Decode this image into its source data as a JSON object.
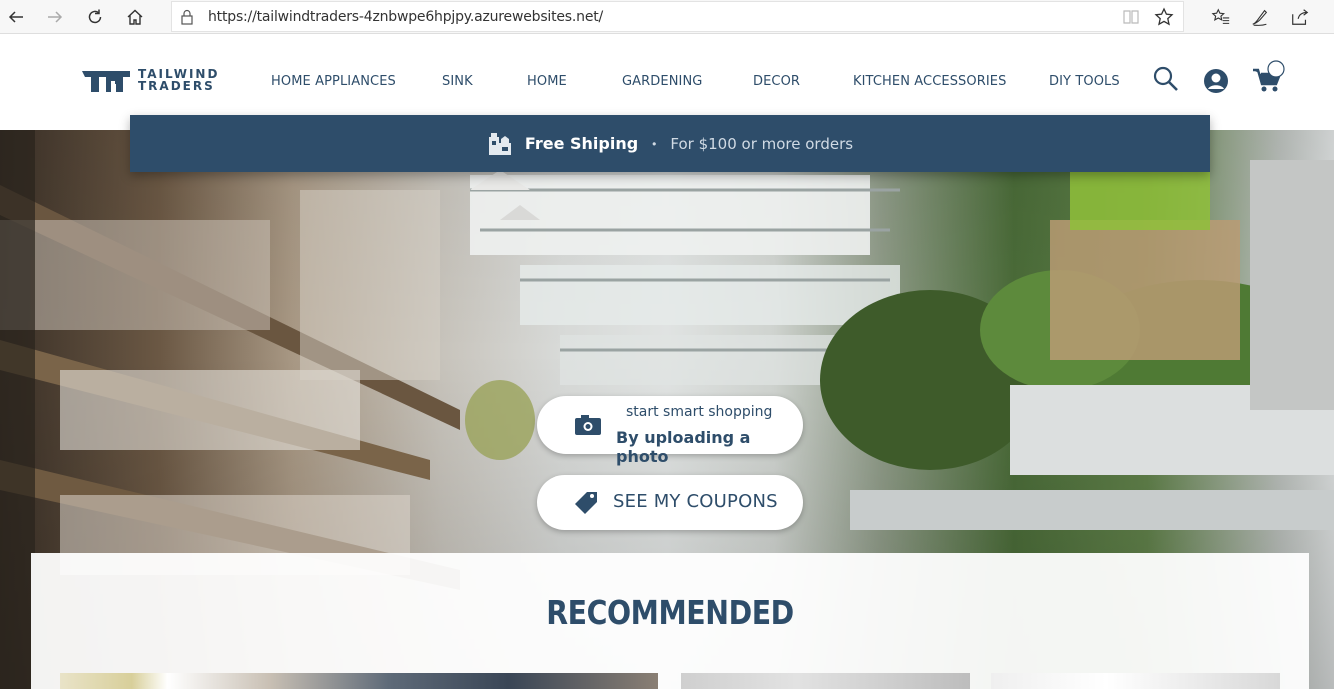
{
  "browser": {
    "url": "https://tailwindtraders-4znbwpe6hpjpy.azurewebsites.net/"
  },
  "header": {
    "logo_line1": "TAILWIND",
    "logo_line2": "TRADERS",
    "nav": [
      {
        "label": "HOME APPLIANCES"
      },
      {
        "label": "SINK"
      },
      {
        "label": "HOME"
      },
      {
        "label": "GARDENING"
      },
      {
        "label": "DECOR"
      },
      {
        "label": "KITCHEN ACCESSORIES"
      },
      {
        "label": "DIY TOOLS"
      }
    ],
    "icons": [
      "search-icon",
      "user-icon",
      "cart-icon"
    ]
  },
  "shipping": {
    "title": "Free Shiping",
    "subtitle": "For $100 or more orders"
  },
  "hero": {
    "upload_sub": "start smart shopping",
    "upload_main": "By uploading a photo",
    "coupons": "SEE MY COUPONS"
  },
  "recommended": {
    "title": "RECOMMENDED"
  },
  "colors": {
    "brand": "#2e4d6a",
    "white": "#ffffff"
  }
}
